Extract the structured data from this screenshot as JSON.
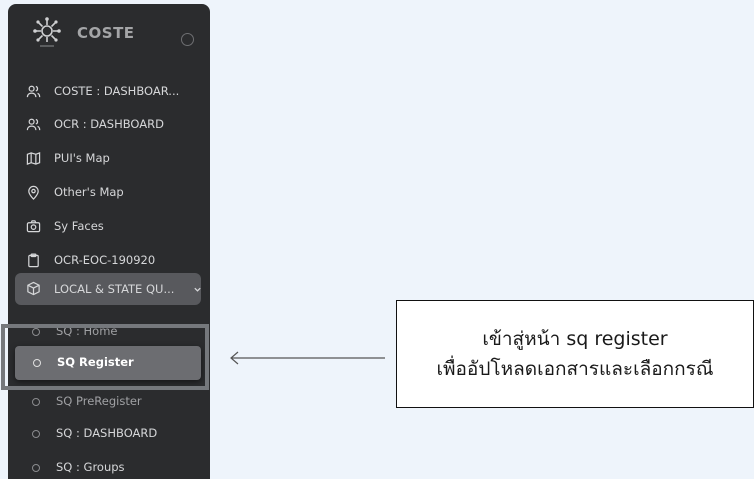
{
  "brand": {
    "name": "COSTE",
    "logo_icon": "virus-icon"
  },
  "nav": [
    {
      "label": "COSTE : DASHBOAR...",
      "icon": "users-icon"
    },
    {
      "label": "OCR : DASHBOARD",
      "icon": "users-icon"
    },
    {
      "label": "PUI's Map",
      "icon": "map-icon"
    },
    {
      "label": "Other's Map",
      "icon": "map-pin-icon"
    },
    {
      "label": "Sy Faces",
      "icon": "camera-icon"
    },
    {
      "label": "OCR-EOC-190920",
      "icon": "clipboard-icon"
    }
  ],
  "group": {
    "label": "LOCAL & STATE QU...",
    "icon": "box-icon",
    "expanded": true
  },
  "sub_items": [
    {
      "label": "SQ : Home",
      "state": "partially-hidden"
    },
    {
      "label": "SQ Register",
      "state": "active"
    },
    {
      "label": "SQ PreRegister",
      "state": "partially-hidden"
    },
    {
      "label": "SQ : DASHBOARD",
      "state": "normal"
    },
    {
      "label": "SQ : Groups",
      "state": "normal"
    }
  ],
  "callout": {
    "line1": "เข้าสู่หน้า sq register",
    "line2": "เพื่ออัปโหลดเอกสารและเลือกกรณี"
  },
  "colors": {
    "page_background": "#eef4fb",
    "sidebar_background": "#2b2c2e",
    "group_background": "#58595d",
    "active_item_background": "#6c6d71",
    "highlight_border": "#75787c"
  }
}
